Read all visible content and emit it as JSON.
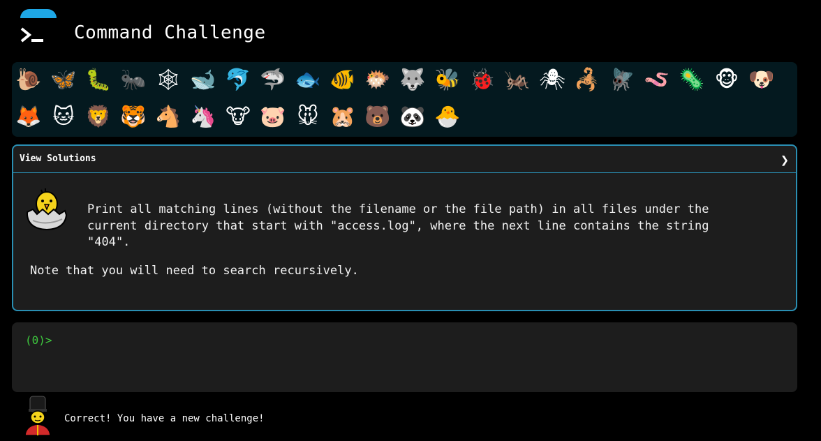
{
  "header": {
    "title": "Command Challenge",
    "logo_icon": "terminal-icon"
  },
  "levels": [
    {
      "name": "snail",
      "glyph": "🐌"
    },
    {
      "name": "butterfly",
      "glyph": "🦋"
    },
    {
      "name": "bug",
      "glyph": "🐛"
    },
    {
      "name": "ant",
      "glyph": "🐜"
    },
    {
      "name": "spider-web",
      "glyph": "🕸"
    },
    {
      "name": "whale",
      "glyph": "🐋"
    },
    {
      "name": "dolphin",
      "glyph": "🐬"
    },
    {
      "name": "shark",
      "glyph": "🦈"
    },
    {
      "name": "fish",
      "glyph": "🐟"
    },
    {
      "name": "tropical-fish",
      "glyph": "🐠"
    },
    {
      "name": "blowfish",
      "glyph": "🐡"
    },
    {
      "name": "wolf",
      "glyph": "🐺"
    },
    {
      "name": "bee",
      "glyph": "🐝"
    },
    {
      "name": "ladybug",
      "glyph": "🐞"
    },
    {
      "name": "cricket",
      "glyph": "🦗"
    },
    {
      "name": "spider",
      "glyph": "🕷"
    },
    {
      "name": "scorpion",
      "glyph": "🦂"
    },
    {
      "name": "fly",
      "glyph": "🪰"
    },
    {
      "name": "worm",
      "glyph": "🪱"
    },
    {
      "name": "microbe",
      "glyph": "🦠"
    },
    {
      "name": "monkey",
      "glyph": "🐵"
    },
    {
      "name": "dog",
      "glyph": "🐶"
    },
    {
      "name": "fox",
      "glyph": "🦊"
    },
    {
      "name": "cat",
      "glyph": "🐱"
    },
    {
      "name": "lion",
      "glyph": "🦁"
    },
    {
      "name": "tiger",
      "glyph": "🐯"
    },
    {
      "name": "horse",
      "glyph": "🐴"
    },
    {
      "name": "unicorn",
      "glyph": "🦄"
    },
    {
      "name": "cow",
      "glyph": "🐮"
    },
    {
      "name": "pig",
      "glyph": "🐷"
    },
    {
      "name": "mouse",
      "glyph": "🐭"
    },
    {
      "name": "hamster",
      "glyph": "🐹"
    },
    {
      "name": "bear",
      "glyph": "🐻"
    },
    {
      "name": "panda",
      "glyph": "🐼"
    },
    {
      "name": "hatching-chick",
      "glyph": "🐣"
    }
  ],
  "solutions": {
    "label": "View Solutions",
    "chevron": "❯"
  },
  "challenge": {
    "text": "Print all matching lines (without the filename or the file path) in all files under the current directory that start with \"access.log\", where the next line contains the string \"404\".",
    "note": "Note that you will need to search recursively."
  },
  "terminal": {
    "prompt": "(0)>",
    "value": ""
  },
  "status": {
    "message": "Correct! You have a new challenge!"
  },
  "colors": {
    "accent": "#2a8fb3",
    "prompt": "#3ec93e",
    "panel": "#1d1d1d",
    "levels_bg": "#04191f"
  }
}
